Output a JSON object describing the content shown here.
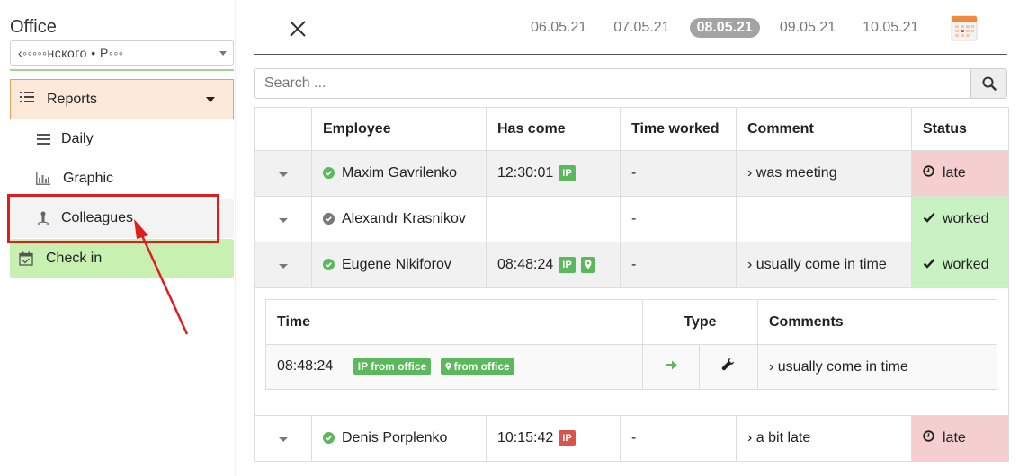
{
  "sidebar": {
    "title": "Office",
    "select_value": "‹◦◦◦◦◦нского • Р◦◦◦",
    "reports_label": "Reports",
    "items": [
      {
        "label": "Daily",
        "icon": "list-icon"
      },
      {
        "label": "Graphic",
        "icon": "bar-chart-icon"
      },
      {
        "label": "Colleagues",
        "icon": "user-pin-icon"
      }
    ],
    "checkin_label": "Check in"
  },
  "header": {
    "dates": [
      "06.05.21",
      "07.05.21",
      "08.05.21",
      "09.05.21",
      "10.05.21"
    ],
    "active_date": "08.05.21"
  },
  "search": {
    "placeholder": "Search ..."
  },
  "table": {
    "headers": [
      "Employee",
      "Has come",
      "Time worked",
      "Comment",
      "Status"
    ],
    "rows": [
      {
        "employee": "Maxim Gavrilenko",
        "has_come": "12:30:01",
        "badge": "IP",
        "time_worked": "-",
        "comment": "›  was meeting",
        "status": "late"
      },
      {
        "employee": "Alexandr Krasnikov",
        "has_come": "",
        "badge": "",
        "time_worked": "-",
        "comment": "",
        "status": "worked"
      },
      {
        "employee": "Eugene Nikiforov",
        "has_come": "08:48:24",
        "badge": "IP",
        "time_worked": "-",
        "comment": "›  usually come in time",
        "status": "worked"
      },
      {
        "employee": "Denis Porplenko",
        "has_come": "10:15:42",
        "badge": "IP",
        "time_worked": "-",
        "comment": "›  a bit late",
        "status": "late"
      }
    ]
  },
  "detail": {
    "headers": [
      "Time",
      "Type",
      "Comments"
    ],
    "row": {
      "time": "08:48:24",
      "tag_ip": "IP from office",
      "tag_location": "from office",
      "comment": "› usually come in time"
    }
  },
  "colors": {
    "late_bg": "#f5cfcf",
    "worked_bg": "#c9f2c3",
    "badge_green": "#5cb85c",
    "badge_red": "#d9534f",
    "reports_bg": "#fde9d9",
    "checkin_bg": "#c8f0b0",
    "annotation": "#e21c1c"
  }
}
